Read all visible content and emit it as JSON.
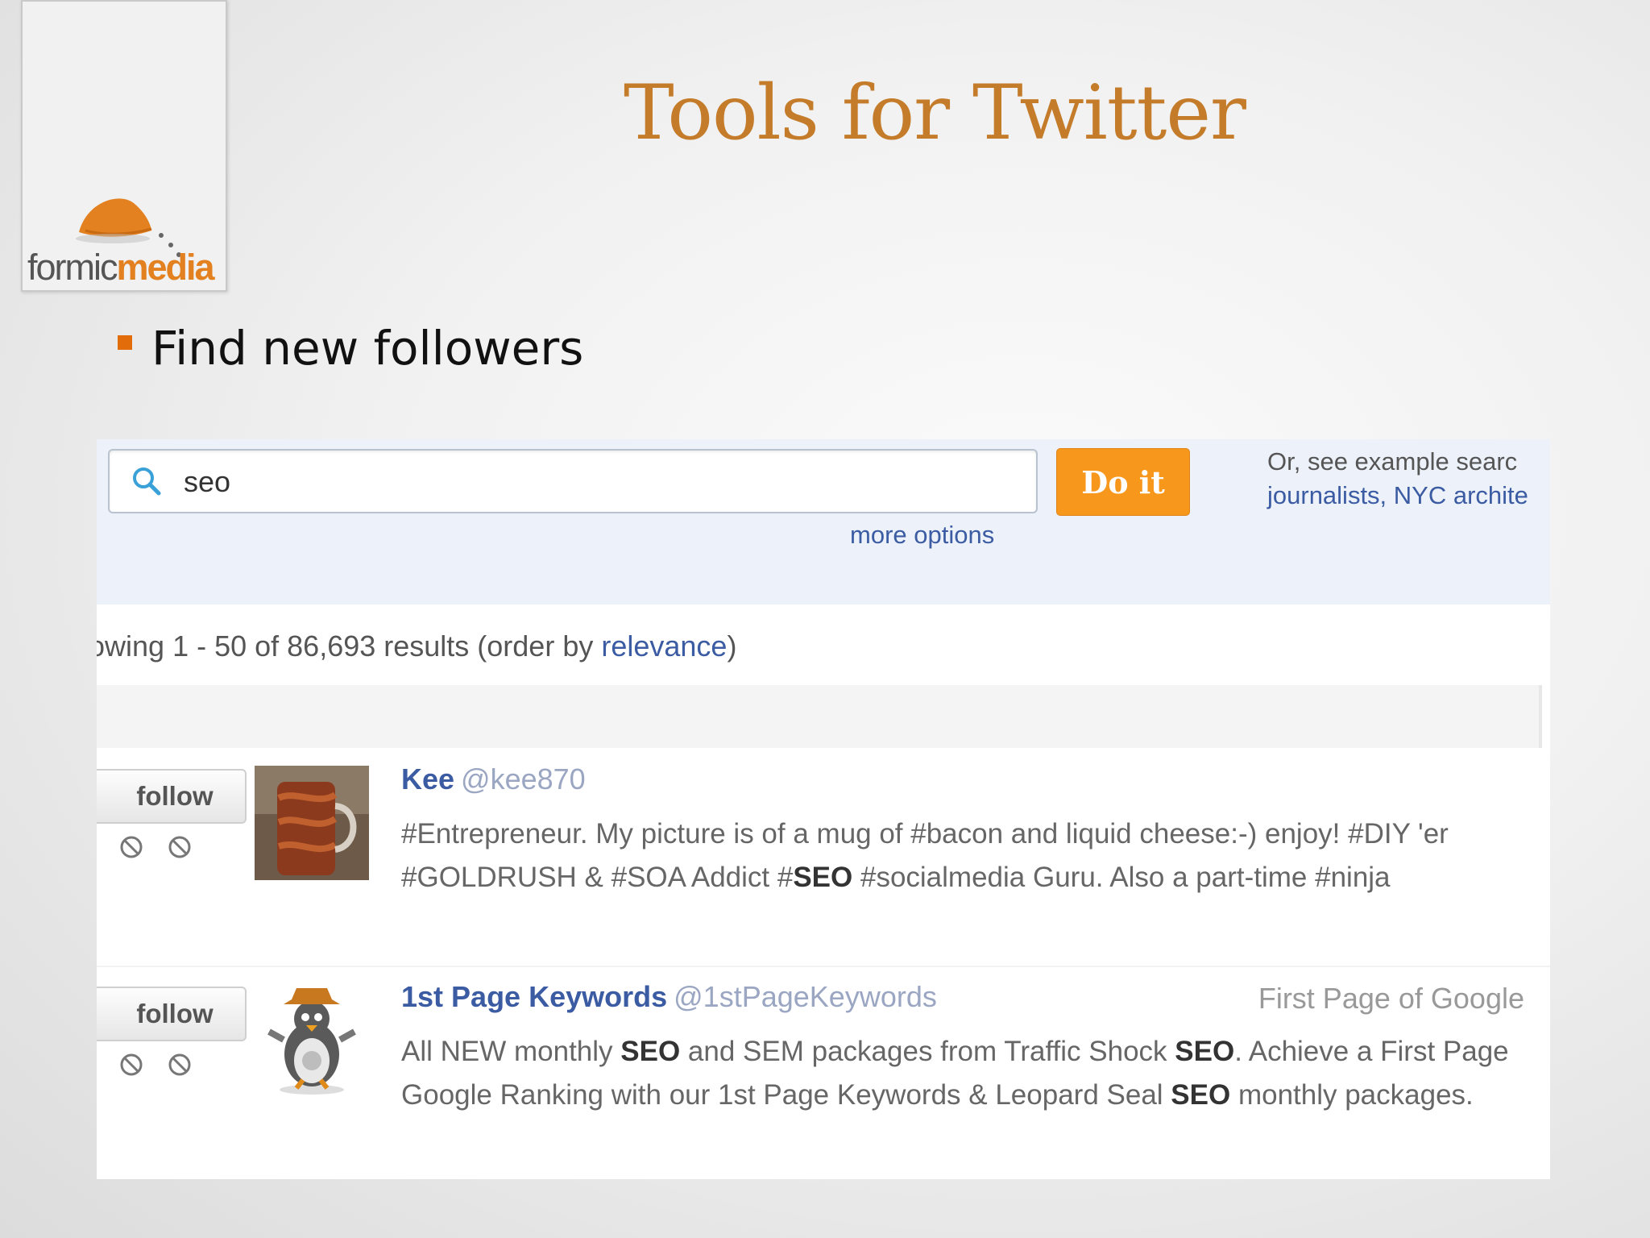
{
  "logo": {
    "text_part1": "formic",
    "text_part2": "media"
  },
  "slide": {
    "title": "Tools for Twitter",
    "bullet": "Find new followers"
  },
  "colors": {
    "title": "#c47c2a",
    "bullet": "#e36c0a",
    "button_orange": "#f7971c",
    "link_blue": "#3b5ba3"
  },
  "search": {
    "value": "seo",
    "button_label": "Do it",
    "more_options": "more options",
    "example_line1": "Or, see example searc",
    "example_line2": "journalists, NYC archite"
  },
  "results": {
    "count_prefix": "owing 1 - 50 of 86,693 results (order by ",
    "sort_link": "relevance",
    "count_suffix": ")"
  },
  "users": [
    {
      "follow_label": "follow",
      "name": "Kee",
      "handle": "@kee870",
      "location": "",
      "bio": [
        {
          "text": "#Entrepreneur. My picture is of a mug of #bacon and liquid cheese:-) enjoy! #DIY 'er #GOLDRUSH & #SOA Addict #",
          "bold": false
        },
        {
          "text": "SEO",
          "bold": true
        },
        {
          "text": " #socialmedia Guru. Also a part-time #ninja",
          "bold": false
        }
      ],
      "avatar_icon": "bacon-mug-avatar"
    },
    {
      "follow_label": "follow",
      "name": "1st Page Keywords",
      "handle": "@1stPageKeywords",
      "location": "First Page of Google",
      "bio": [
        {
          "text": "All NEW monthly ",
          "bold": false
        },
        {
          "text": "SEO",
          "bold": true
        },
        {
          "text": " and SEM packages from Traffic Shock ",
          "bold": false
        },
        {
          "text": "SEO",
          "bold": true
        },
        {
          "text": ". Achieve a First Page Google Ranking with our 1st Page Keywords & Leopard Seal ",
          "bold": false
        },
        {
          "text": "SEO",
          "bold": true
        },
        {
          "text": " monthly packages.",
          "bold": false
        }
      ],
      "avatar_icon": "cowboy-penguin-avatar"
    }
  ]
}
